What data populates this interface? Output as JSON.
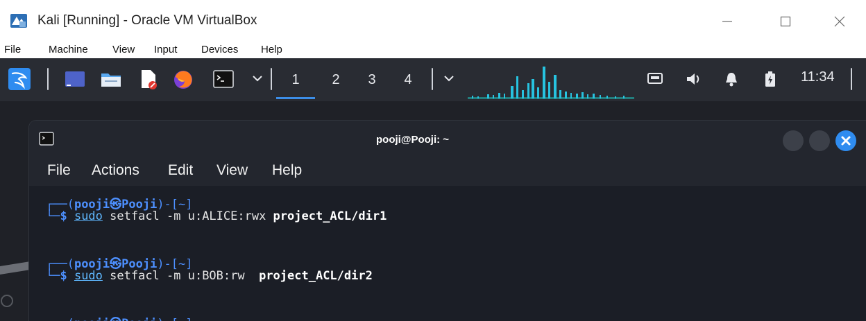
{
  "vbox": {
    "title": "Kali [Running] - Oracle VM VirtualBox",
    "menu": [
      "File",
      "Machine",
      "View",
      "Input",
      "Devices",
      "Help"
    ]
  },
  "panel": {
    "workspaces": [
      "1",
      "2",
      "3",
      "4"
    ],
    "active_workspace": "1",
    "clock": "11:34",
    "accent_color": "#3c8ee8"
  },
  "terminal": {
    "title": "pooji@Pooji: ~",
    "menu": [
      "File",
      "Actions",
      "Edit",
      "View",
      "Help"
    ],
    "prompt": {
      "top_frame": "┌──(",
      "user_host": "pooji㉿Pooji",
      "dir_part": ")-[~]",
      "arrow": "└─$ "
    },
    "commands": [
      {
        "cmd": "sudo",
        "args": " setfacl -m u:ALICE:rwx ",
        "target": "project_ACL/dir1"
      },
      {
        "cmd": "sudo",
        "args": " setfacl -m u:BOB:rw  ",
        "target": "project_ACL/dir2"
      }
    ]
  }
}
